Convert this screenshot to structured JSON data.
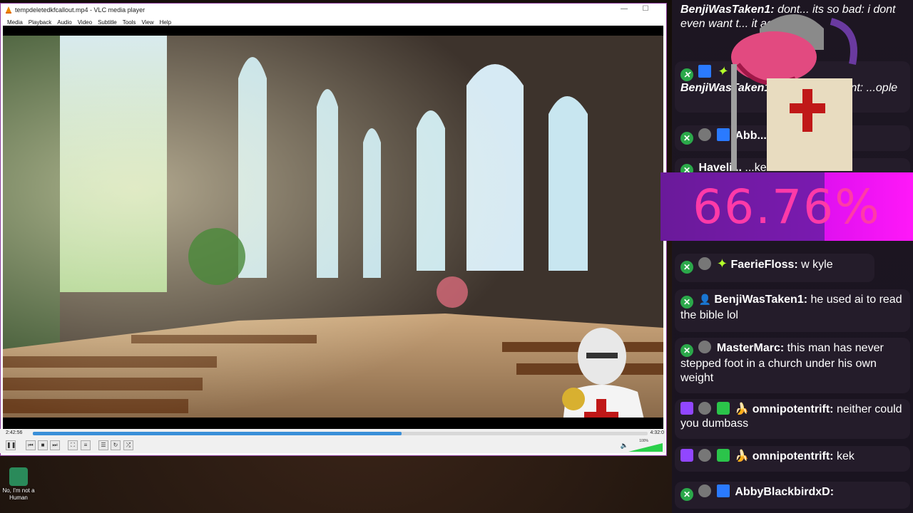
{
  "window": {
    "title": "tempdeletedkfcallout.mp4 - VLC media player",
    "minimize": "—",
    "maximize": "☐"
  },
  "menu": [
    "Media",
    "Playback",
    "Audio",
    "Video",
    "Subtitle",
    "Tools",
    "View",
    "Help"
  ],
  "player": {
    "elapsed": "2:42:56",
    "total": "4:32:0",
    "progress_fraction": 0.6,
    "volume_label": "100%"
  },
  "desktop_icon": {
    "label": "No, I'm not a Human"
  },
  "overlay": {
    "percent": "66.76%"
  },
  "chat": {
    "messages": [
      {
        "user": "BenjiWasTaken1:",
        "text": "dont... its so bad: i dont even want t... it actually is",
        "style": "italic"
      },
      {
        "user": "BenjiWasTaken1:",
        "text": "...well of content: ...ople",
        "style": "italic"
      },
      {
        "user": "Abb...",
        "text": "",
        "style": "normal"
      },
      {
        "user": "Haveli...",
        "text": "...ke on",
        "style": "normal"
      },
      {
        "user": "FaerieFloss:",
        "text": "w kyle",
        "style": "normal"
      },
      {
        "user": "BenjiWasTaken1:",
        "text": "he used ai to read the bible lol",
        "style": "normal"
      },
      {
        "user": "MasterMarc:",
        "text": "this man has never stepped foot in a church under his own weight",
        "style": "normal"
      },
      {
        "user": "omnipotentrift:",
        "text": "neither could you dumbass",
        "style": "normal"
      },
      {
        "user": "omnipotentrift:",
        "text": "kek",
        "style": "normal"
      },
      {
        "user": "AbbyBlackbirdxD:",
        "text": "",
        "style": "normal"
      }
    ]
  },
  "colors": {
    "seek_fill": "#3a8fd8",
    "mod_badge": "#2ba84a",
    "twitch_purple": "#9146ff",
    "percent_pink": "#ff3aa8",
    "banner_magenta": "#ff18f8"
  }
}
